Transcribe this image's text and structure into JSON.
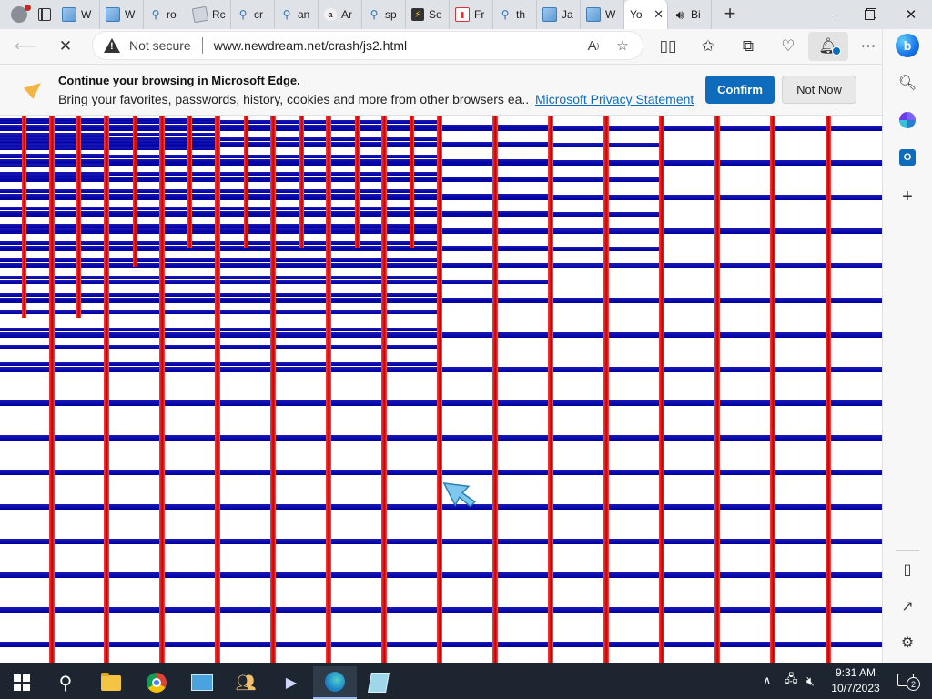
{
  "browser": {
    "tabs": [
      {
        "label": "W",
        "icon": "ie-page-icon"
      },
      {
        "label": "W",
        "icon": "ie-page-icon"
      },
      {
        "label": "ro",
        "icon": "search-icon"
      },
      {
        "label": "Rc",
        "icon": "page-icon"
      },
      {
        "label": "cr",
        "icon": "search-icon"
      },
      {
        "label": "an",
        "icon": "search-icon"
      },
      {
        "label": "Ar",
        "icon": "amazon-icon"
      },
      {
        "label": "sp",
        "icon": "search-icon"
      },
      {
        "label": "Se",
        "icon": "bolt-icon"
      },
      {
        "label": "Fr",
        "icon": "red-page-icon"
      },
      {
        "label": "th",
        "icon": "search-icon"
      },
      {
        "label": "Ja",
        "icon": "ie-page-icon"
      },
      {
        "label": "W",
        "icon": "ie-page-icon"
      },
      {
        "label": "Yo",
        "icon": "none",
        "active": true
      },
      {
        "label": "Bi",
        "icon": "audio-icon"
      }
    ],
    "address": {
      "security_label": "Not secure",
      "url": "www.newdream.net/crash/js2.html"
    }
  },
  "infobar": {
    "title": "Continue your browsing in Microsoft Edge.",
    "text": "Bring your favorites, passwords, history, cookies and more from other browsers ea...",
    "link": "Microsoft Privacy Statement",
    "confirm_label": "Confirm",
    "notnow_label": "Not Now"
  },
  "page": {
    "colors": {
      "horizontal_bar": "#0000b0",
      "vertical_bar": "#d40000",
      "background": "#ffffff"
    }
  },
  "taskbar": {
    "clock_time": "9:31 AM",
    "clock_date": "10/7/2023",
    "notification_count": "2"
  }
}
